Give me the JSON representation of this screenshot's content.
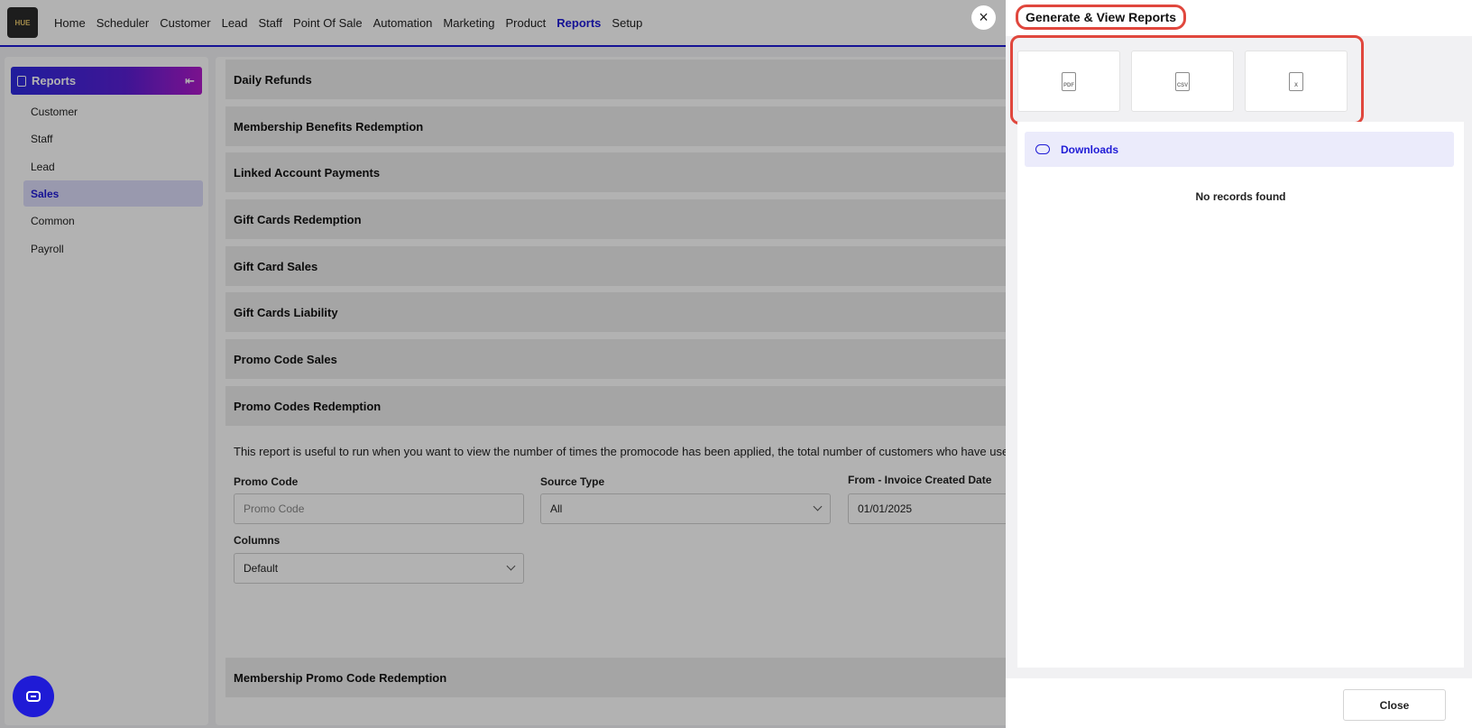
{
  "logo": {
    "text": "HUE"
  },
  "nav": {
    "items": [
      "Home",
      "Scheduler",
      "Customer",
      "Lead",
      "Staff",
      "Point Of Sale",
      "Automation",
      "Marketing",
      "Product",
      "Reports",
      "Setup"
    ],
    "active": "Reports"
  },
  "sidebar": {
    "title": "Reports",
    "items": [
      {
        "label": "Customer"
      },
      {
        "label": "Staff"
      },
      {
        "label": "Lead"
      },
      {
        "label": "Sales"
      },
      {
        "label": "Common"
      },
      {
        "label": "Payroll"
      }
    ],
    "active": "Sales"
  },
  "main": {
    "accordions": [
      "Daily Refunds",
      "Membership Benefits Redemption",
      "Linked Account Payments",
      "Gift Cards Redemption",
      "Gift Card Sales",
      "Gift Cards Liability",
      "Promo Code Sales",
      "Promo Codes Redemption"
    ],
    "description": "This report is useful to run when you want to view the number of times the promocode has been applied, the total number of customers who have used the pro",
    "form": {
      "promo_code_label": "Promo Code",
      "promo_code_placeholder": "Promo Code",
      "source_type_label": "Source Type",
      "source_type_value": "All",
      "from_date_label": "From - Invoice Created Date",
      "from_date_value": "01/01/2025",
      "columns_label": "Columns",
      "columns_value": "Default"
    },
    "last_accordion": "Membership Promo Code Redemption"
  },
  "overlay_close": "×",
  "panel": {
    "title": "Generate & View Reports",
    "exports": [
      {
        "label": "PDF",
        "icon": "pdf-file-icon"
      },
      {
        "label": "CSV",
        "icon": "csv-file-icon"
      },
      {
        "label": "X",
        "icon": "excel-file-icon"
      }
    ],
    "downloads_label": "Downloads",
    "empty_message": "No records found",
    "close_label": "Close"
  },
  "colors": {
    "accent": "#1f1bd6",
    "highlight": "#e0473d"
  }
}
